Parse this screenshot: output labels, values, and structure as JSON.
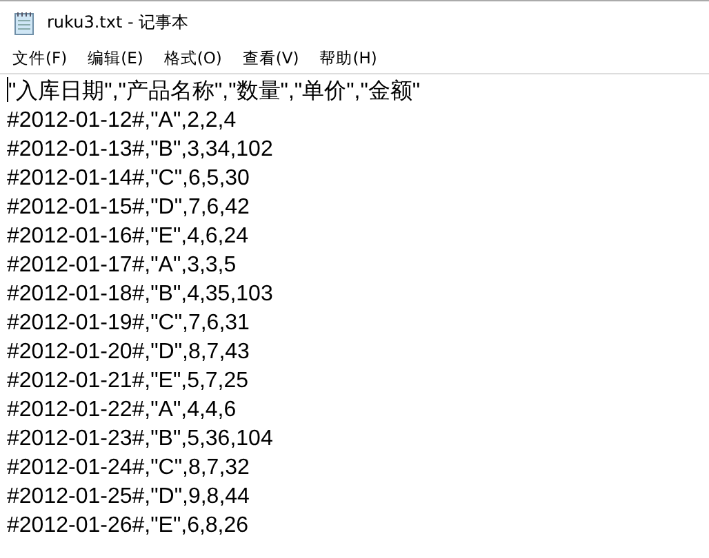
{
  "window": {
    "title": "ruku3.txt - 记事本"
  },
  "menu": [
    "文件(F)",
    "编辑(E)",
    "格式(O)",
    "查看(V)",
    "帮助(H)"
  ],
  "document": {
    "lines": [
      "\"入库日期\",\"产品名称\",\"数量\",\"单价\",\"金额\"",
      "#2012-01-12#,\"A\",2,2,4",
      "#2012-01-13#,\"B\",3,34,102",
      "#2012-01-14#,\"C\",6,5,30",
      "#2012-01-15#,\"D\",7,6,42",
      "#2012-01-16#,\"E\",4,6,24",
      "#2012-01-17#,\"A\",3,3,5",
      "#2012-01-18#,\"B\",4,35,103",
      "#2012-01-19#,\"C\",7,6,31",
      "#2012-01-20#,\"D\",8,7,43",
      "#2012-01-21#,\"E\",5,7,25",
      "#2012-01-22#,\"A\",4,4,6",
      "#2012-01-23#,\"B\",5,36,104",
      "#2012-01-24#,\"C\",8,7,32",
      "#2012-01-25#,\"D\",9,8,44",
      "#2012-01-26#,\"E\",6,8,26"
    ]
  }
}
